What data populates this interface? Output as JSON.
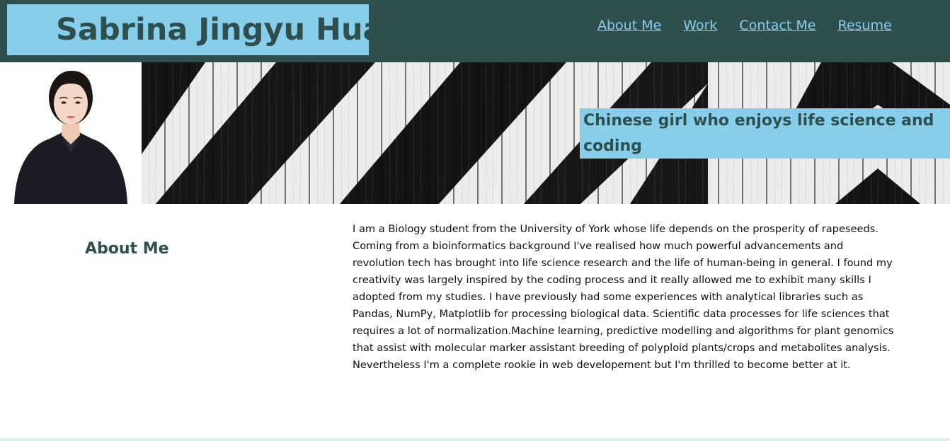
{
  "header": {
    "site_name": "Sabrina Jingyu Hua",
    "nav": [
      {
        "label": "About Me"
      },
      {
        "label": "Work"
      },
      {
        "label": "Contact Me"
      },
      {
        "label": "Resume"
      }
    ]
  },
  "hero": {
    "tagline": "Chinese girl who enjoys life science and coding",
    "portrait_icon": "person-portrait-icon",
    "banner_icon": "striped-wood-banner-image"
  },
  "about": {
    "title": "About Me",
    "body": "I am a Biology student from the University of York whose life depends on the prosperity of rapeseeds. Coming from a bioinformatics background I've realised how much powerful advancements and revolution tech has brought into life science research and the life of human-being in general. I found my creativity was largely inspired by the coding process and it really allowed me to exhibit many skills I adopted from my studies. I have previously had some experiences with analytical libraries such as Pandas, NumPy, Matplotlib for processing biological data. Scientific data processes for life sciences that requires a lot of normalization.Machine learning, predictive modelling and algorithms for plant genomics that assist with molecular marker assistant breeding of polyploid plants/crops and metabolites analysis. Nevertheless I'm a complete rookie in web developement but I'm thrilled to become better at it."
  },
  "colors": {
    "header_bg": "#2f4f4f",
    "accent": "#87ceeb",
    "text_dark": "#2f4f4f"
  }
}
